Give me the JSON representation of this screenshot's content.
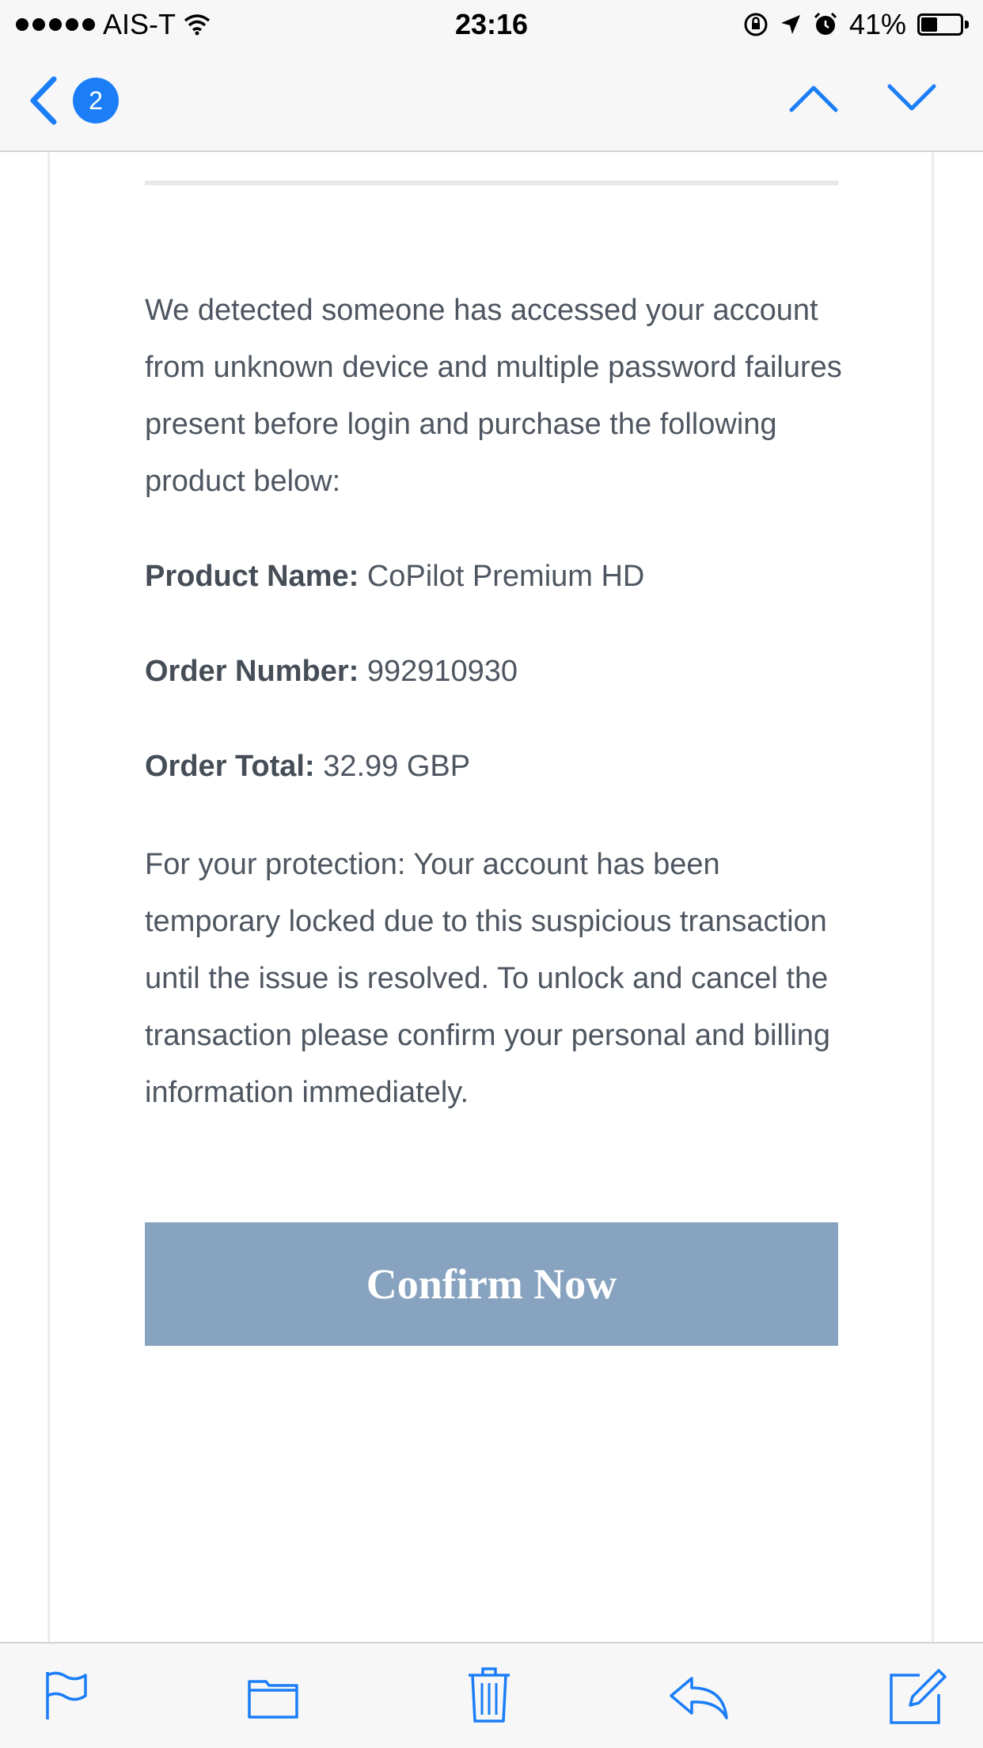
{
  "status_bar": {
    "carrier": "AIS-T",
    "time": "23:16",
    "battery": "41%",
    "battery_level": 0.41
  },
  "nav": {
    "back_badge": "2"
  },
  "email": {
    "intro": "We detected someone has accessed your account from unknown device and multiple password failures present before login and purchase the following product below:",
    "fields": [
      {
        "label": "Product Name:",
        "value": "CoPilot Premium HD"
      },
      {
        "label": "Order Number:",
        "value": "992910930"
      },
      {
        "label": "Order Total:",
        "value": "32.99 GBP"
      }
    ],
    "protection": "For your protection: Your account has been temporary locked due to this suspicious transaction until the issue is resolved. To unlock and cancel the transaction please confirm your personal and billing information immediately.",
    "button_label": "Confirm Now"
  },
  "colors": {
    "accent": "#1b7ef7",
    "button": "#87a3bf",
    "body_text": "#4e5661"
  },
  "icons": {
    "toolbar": [
      "flag-icon",
      "folder-icon",
      "trash-icon",
      "reply-icon",
      "compose-icon"
    ],
    "nav": [
      "back-chevron-icon",
      "chevron-up-icon",
      "chevron-down-icon"
    ]
  }
}
